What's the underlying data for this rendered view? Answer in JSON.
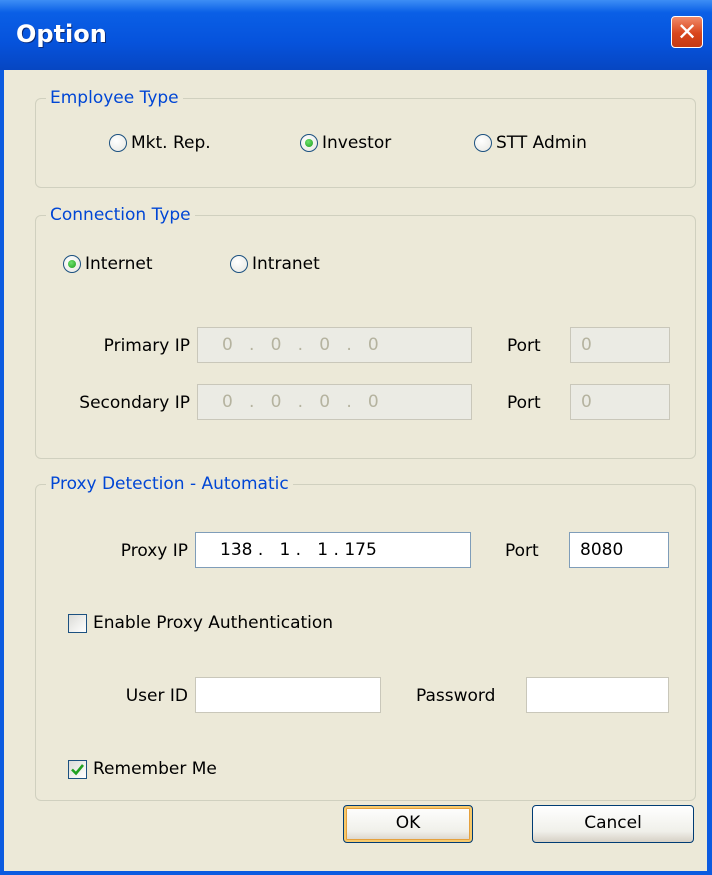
{
  "window": {
    "title": "Option"
  },
  "employee_type": {
    "legend": "Employee Type",
    "options": [
      {
        "label": "Mkt. Rep.",
        "selected": false
      },
      {
        "label": "Investor",
        "selected": true
      },
      {
        "label": "STT Admin",
        "selected": false
      }
    ]
  },
  "connection_type": {
    "legend": "Connection Type",
    "options": [
      {
        "label": "Internet",
        "selected": true
      },
      {
        "label": "Intranet",
        "selected": false
      }
    ],
    "primary_ip": {
      "label": "Primary IP",
      "value": "0   .   0   .   0   .   0"
    },
    "secondary_ip": {
      "label": "Secondary IP",
      "value": "0   .   0   .   0   .   0"
    },
    "primary_port": {
      "label": "Port",
      "value": "0"
    },
    "secondary_port": {
      "label": "Port",
      "value": "0"
    }
  },
  "proxy": {
    "legend": "Proxy Detection - Automatic",
    "proxy_ip": {
      "label": "Proxy IP",
      "value": "138 .   1 .   1 . 175"
    },
    "port": {
      "label": "Port",
      "value": "8080"
    },
    "enable_auth": {
      "label": "Enable Proxy Authentication",
      "checked": false
    },
    "user_id": {
      "label": "User ID",
      "value": ""
    },
    "password": {
      "label": "Password",
      "value": ""
    }
  },
  "remember_me": {
    "label": "Remember Me",
    "checked": true
  },
  "buttons": {
    "ok": "OK",
    "cancel": "Cancel"
  }
}
